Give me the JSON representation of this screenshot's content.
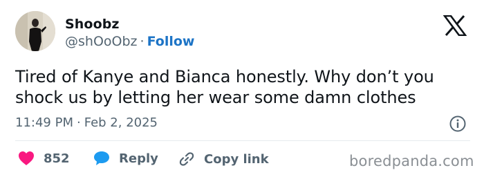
{
  "tweet": {
    "author": {
      "display_name": "Shoobz",
      "handle": "@shOoObz",
      "separator": "·",
      "follow_label": "Follow",
      "avatar_icon": "profile-photo"
    },
    "platform_icon": "x-logo-icon",
    "text": "Tired of Kanye and Bianca honestly. Why don’t you shock us by letting her wear some damn clothes",
    "timestamp": {
      "time": "11:49 PM",
      "separator": "·",
      "date": "Feb 2, 2025"
    },
    "info_icon": "info-circle-icon",
    "actions": {
      "like": {
        "icon": "heart-icon",
        "count": "852",
        "color": "#f91880"
      },
      "reply": {
        "icon": "speech-bubble-icon",
        "label": "Reply",
        "color": "#1d9bf0"
      },
      "copy": {
        "icon": "link-icon",
        "label": "Copy link"
      }
    }
  },
  "watermark": "boredpanda.com",
  "colors": {
    "text_primary": "#0f1419",
    "text_secondary": "#536471",
    "link_blue": "#1d74c6",
    "like_pink": "#f91880",
    "reply_blue": "#1d9bf0"
  }
}
